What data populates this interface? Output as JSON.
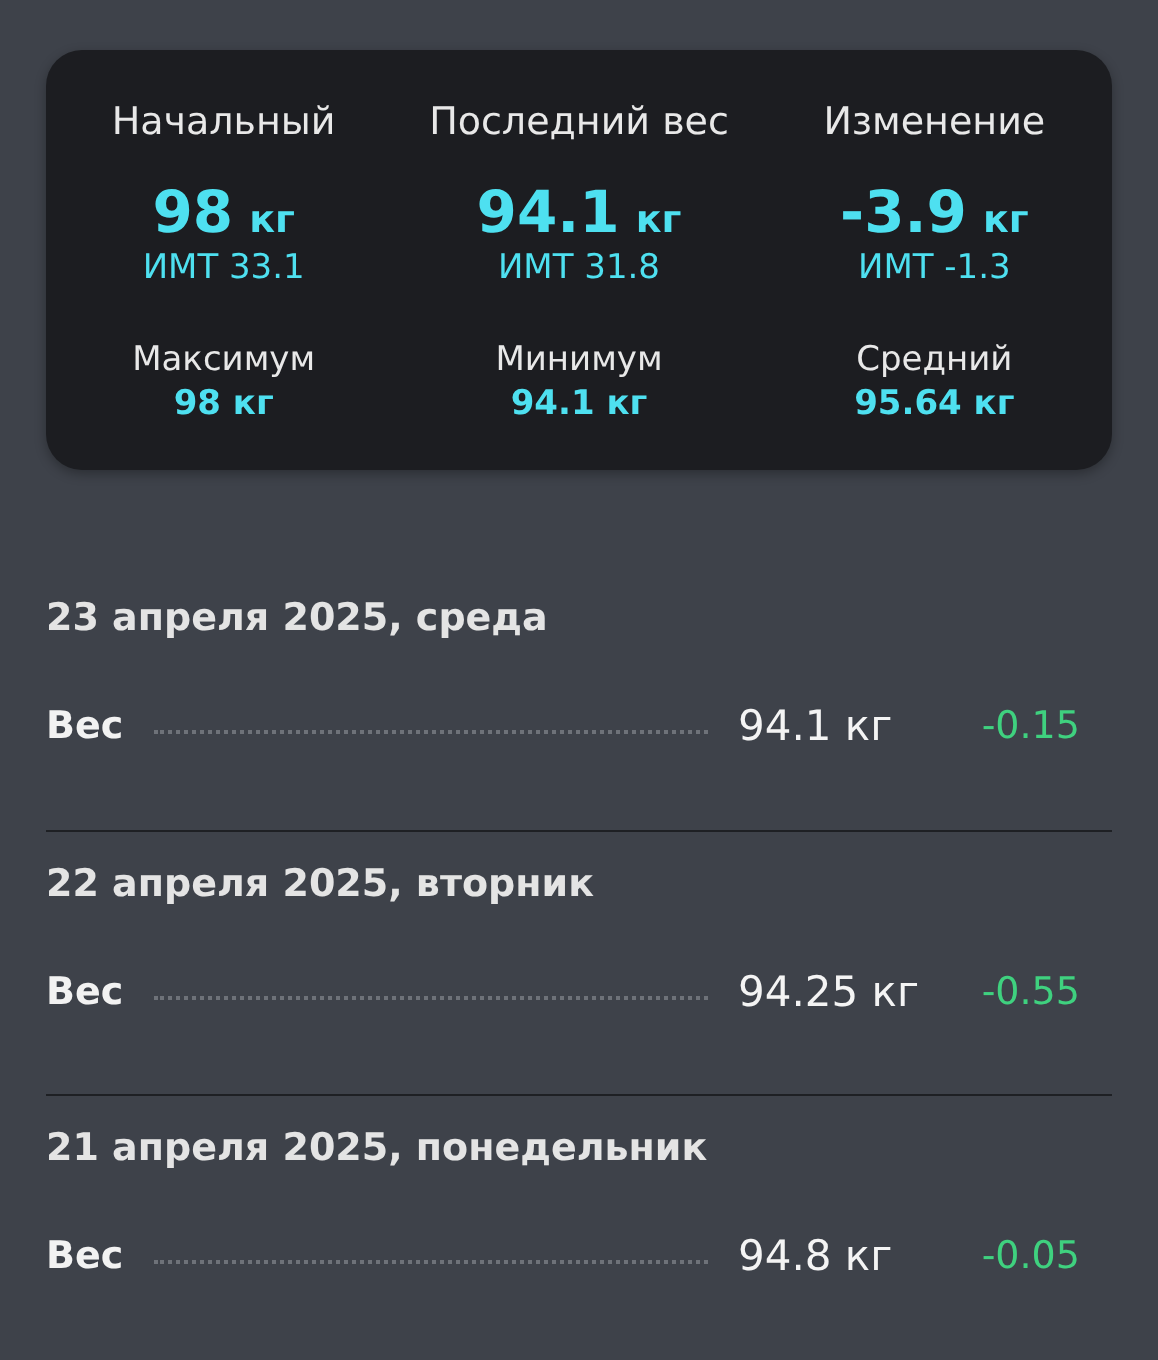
{
  "summary": {
    "columns": [
      {
        "label": "Начальный",
        "value": "98",
        "unit": "кг",
        "bmi": "ИМТ 33.1"
      },
      {
        "label": "Последний вес",
        "value": "94.1",
        "unit": "кг",
        "bmi": "ИМТ 31.8"
      },
      {
        "label": "Изменение",
        "value": "-3.9",
        "unit": "кг",
        "bmi": "ИМТ -1.3"
      }
    ],
    "extremes": [
      {
        "label": "Максимум",
        "value": "98 кг"
      },
      {
        "label": "Минимум",
        "value": "94.1 кг"
      },
      {
        "label": "Средний",
        "value": "95.64 кг"
      }
    ]
  },
  "entries": [
    {
      "date": "23 апреля 2025, среда",
      "label": "Вес",
      "weight": "94.1 кг",
      "change": "-0.15"
    },
    {
      "date": "22 апреля 2025, вторник",
      "label": "Вес",
      "weight": "94.25 кг",
      "change": "-0.55"
    },
    {
      "date": "21 апреля 2025, понедельник",
      "label": "Вес",
      "weight": "94.8 кг",
      "change": "-0.05"
    }
  ]
}
